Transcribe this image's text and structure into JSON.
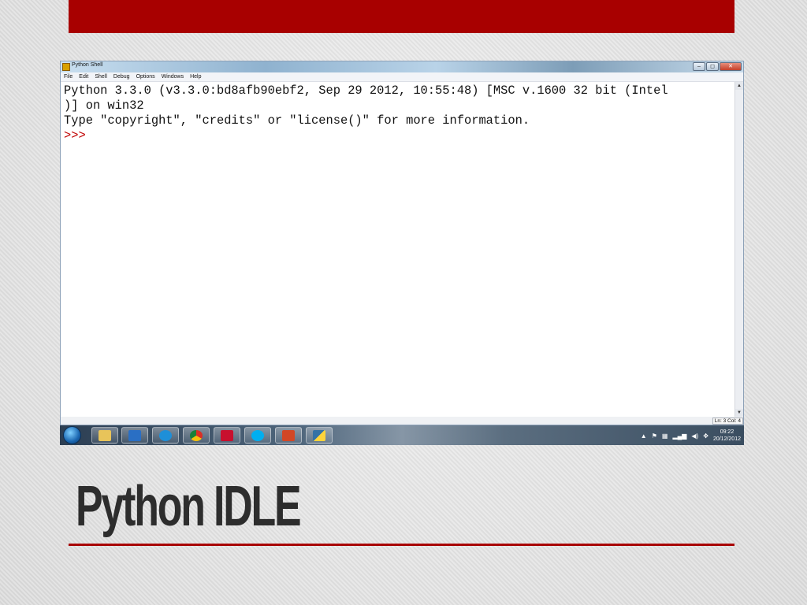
{
  "window": {
    "title": "Python Shell",
    "controls": {
      "minimize": "‒",
      "maximize": "◻",
      "close": "✕"
    }
  },
  "menu": [
    "File",
    "Edit",
    "Shell",
    "Debug",
    "Options",
    "Windows",
    "Help"
  ],
  "shell": {
    "line1": "Python 3.3.0 (v3.3.0:bd8afb90ebf2, Sep 29 2012, 10:55:48) [MSC v.1600 32 bit (Intel",
    "line2": ")] on win32",
    "line3": "Type \"copyright\", \"credits\" or \"license()\" for more information.",
    "prompt": ">>>"
  },
  "statusbar": {
    "lncol": "Ln: 3 Col: 4"
  },
  "taskbar": {
    "icons": [
      "windows-explorer-icon",
      "media-player-icon",
      "internet-explorer-icon",
      "chrome-icon",
      "acrobat-icon",
      "skype-icon",
      "powerpoint-icon",
      "python-icon"
    ],
    "clock_time": "09:22",
    "clock_date": "20/12/2012",
    "tray_arrow": "▲"
  },
  "slide": {
    "title": "Python IDLE"
  },
  "colors": {
    "accent": "#a80000",
    "prompt": "#c00000"
  }
}
